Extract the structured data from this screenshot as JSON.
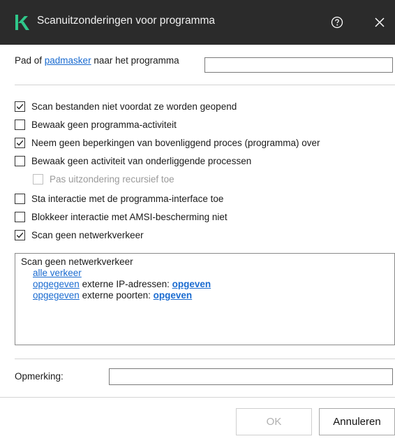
{
  "window": {
    "title": "Scanuitzonderingen voor programma",
    "logo_letter": "K",
    "accent_color": "#2fc78a"
  },
  "path": {
    "label_prefix": "Pad of ",
    "label_link": "padmasker",
    "label_suffix": " naar het programma",
    "value": ""
  },
  "options": [
    {
      "label": "Scan bestanden niet voordat ze worden geopend",
      "checked": true,
      "enabled": true
    },
    {
      "label": "Bewaak geen programma-activiteit",
      "checked": false,
      "enabled": true
    },
    {
      "label": "Neem geen beperkingen van bovenliggend proces (programma) over",
      "checked": true,
      "enabled": true
    },
    {
      "label": "Bewaak geen activiteit van onderliggende processen",
      "checked": false,
      "enabled": true
    },
    {
      "label": "Pas uitzondering recursief toe",
      "checked": false,
      "enabled": false
    },
    {
      "label": "Sta interactie met de programma-interface toe",
      "checked": false,
      "enabled": true
    },
    {
      "label": "Blokkeer interactie met AMSI-bescherming niet",
      "checked": false,
      "enabled": true
    },
    {
      "label": "Scan geen netwerkverkeer",
      "checked": true,
      "enabled": true
    }
  ],
  "network_rules": {
    "heading": "Scan geen netwerkverkeer",
    "all_traffic": "alle verkeer",
    "ip_link": "opgegeven",
    "ip_text": " externe IP-adressen: ",
    "ip_value": "opgeven",
    "port_link": "opgegeven",
    "port_text": " externe poorten: ",
    "port_value": "opgeven"
  },
  "note": {
    "label": "Opmerking:",
    "value": ""
  },
  "buttons": {
    "ok": "OK",
    "cancel": "Annuleren"
  }
}
